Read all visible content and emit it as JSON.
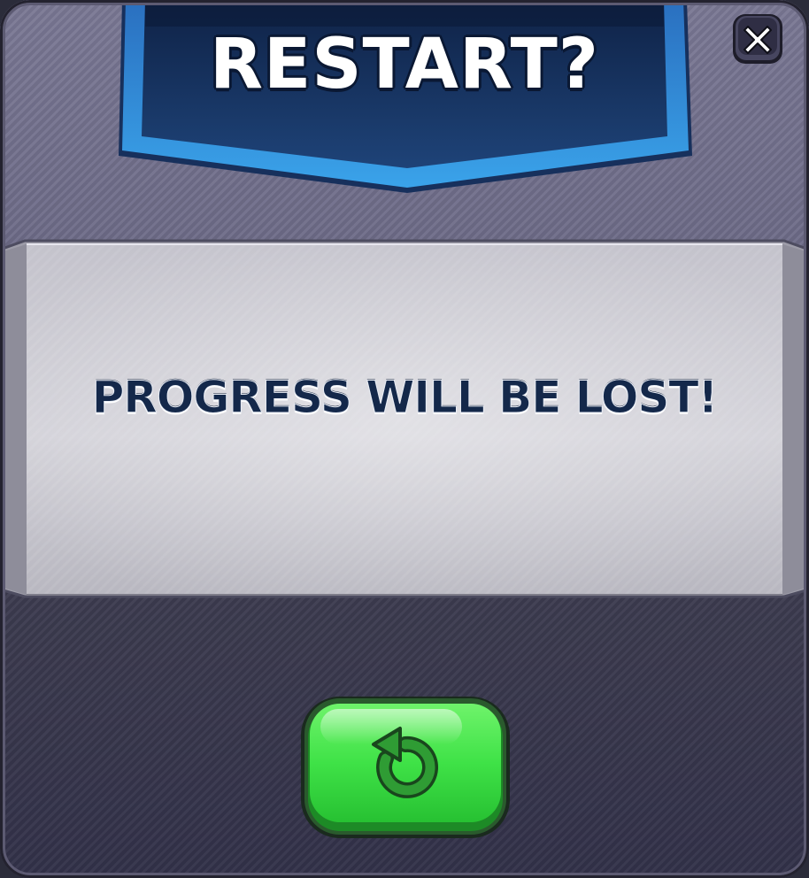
{
  "dialog": {
    "title": "RESTART?",
    "message": "PROGRESS WILL BE LOST!"
  },
  "buttons": {
    "close": {
      "icon": "close-x-icon"
    },
    "restart": {
      "icon": "restart-arrow-icon"
    }
  },
  "colors": {
    "banner_blue": "#1c3a6e",
    "banner_edge": "#2f8fd8",
    "button_green": "#3ee04c",
    "text_navy": "#14284a"
  }
}
